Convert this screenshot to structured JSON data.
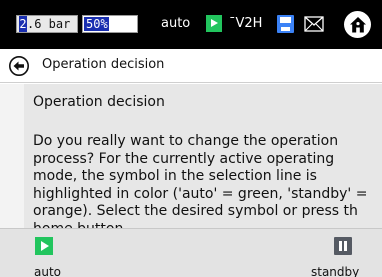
{
  "status_bar": {
    "pressure_prefix": "2",
    "pressure_rest": ".6 bar",
    "charge_percent": "50%",
    "charge_level": 0.5,
    "mode": "auto",
    "v2h_label": "ˉV2H",
    "icons": {
      "play": "play-icon",
      "save": "save-icon",
      "mail": "mail-icon",
      "home": "home-icon"
    },
    "colors": {
      "background": "#000000",
      "play": "#22c55e",
      "save": "#3b82f6",
      "selection": "#1a2fb0"
    }
  },
  "title_bar": {
    "title": "Operation decision",
    "back_icon": "back-arrow-icon"
  },
  "content": {
    "heading": "Operation decision",
    "body": "Do you really want to change the operation process? For the currently active operating mode, the symbol in the selection line is highlighted in color ('auto' = green, 'standby' = orange). Select the desired symbol or press th home button."
  },
  "bottom_bar": {
    "auto": {
      "label": "auto",
      "icon": "play-icon",
      "color": "#22c55e"
    },
    "standby": {
      "label": "standby",
      "icon": "pause-icon",
      "color": "#555a63"
    }
  }
}
